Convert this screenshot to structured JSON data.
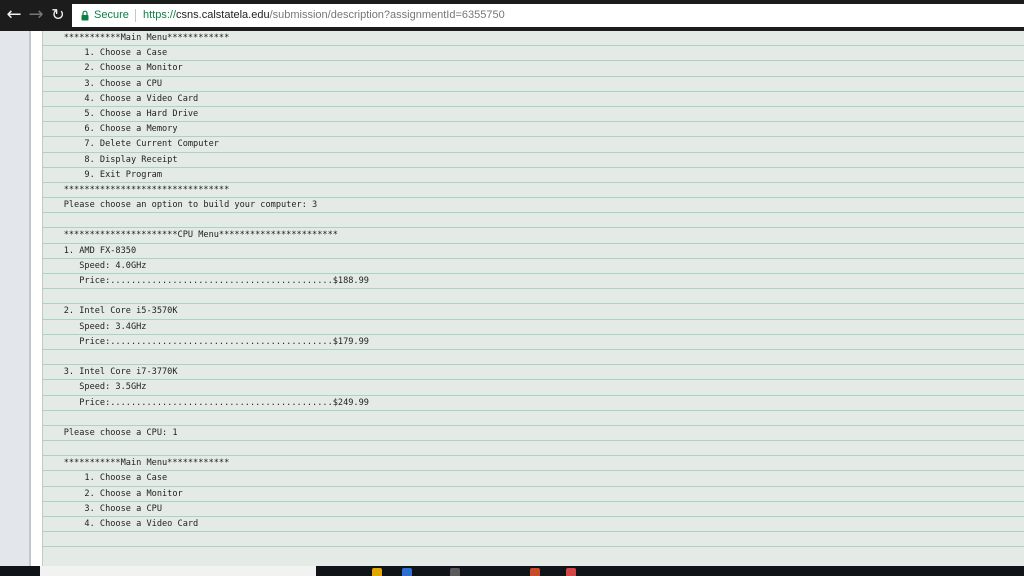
{
  "browser": {
    "secure_label": "Secure",
    "url_protocol": "https://",
    "url_host": "csns.calstatela.edu",
    "url_path": "/submission/description?assignmentId=6355750",
    "icons": {
      "back": "back-arrow-icon",
      "forward": "forward-arrow-icon",
      "reload": "reload-icon",
      "lock": "lock-icon"
    }
  },
  "console": {
    "lines": [
      "    ***********Main Menu************",
      "        1. Choose a Case",
      "        2. Choose a Monitor",
      "        3. Choose a CPU",
      "        4. Choose a Video Card",
      "        5. Choose a Hard Drive",
      "        6. Choose a Memory",
      "        7. Delete Current Computer",
      "        8. Display Receipt",
      "        9. Exit Program",
      "    ********************************",
      "    Please choose an option to build your computer: 3",
      "",
      "    **********************CPU Menu***********************",
      "    1. AMD FX-8350",
      "       Speed: 4.0GHz",
      "       Price:...........................................$188.99",
      "",
      "    2. Intel Core i5-3570K",
      "       Speed: 3.4GHz",
      "       Price:...........................................$179.99",
      "",
      "    3. Intel Core i7-3770K",
      "       Speed: 3.5GHz",
      "       Price:...........................................$249.99",
      "",
      "    Please choose a CPU: 1",
      "",
      "    ***********Main Menu************",
      "        1. Choose a Case",
      "        2. Choose a Monitor",
      "        3. Choose a CPU",
      "        4. Choose a Video Card",
      ""
    ]
  },
  "colors": {
    "chrome_bg": "#1c1c1c",
    "secure_green": "#0b8043",
    "console_bg": "#e4ebe6",
    "rule_line": "#a9d3c3",
    "taskbar_bg": "#101418"
  }
}
